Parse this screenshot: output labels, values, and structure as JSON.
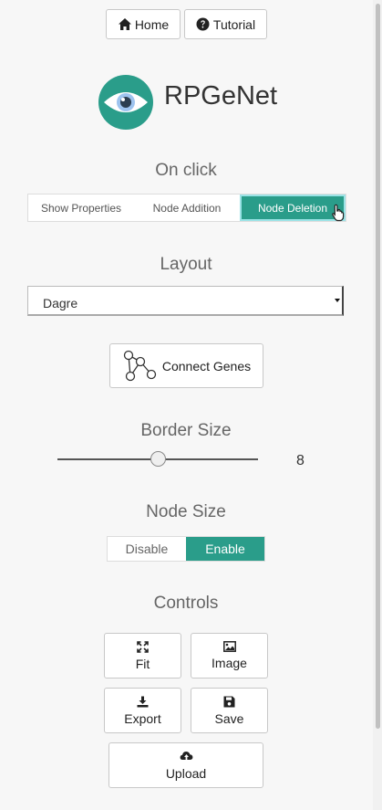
{
  "nav": {
    "home_label": "Home",
    "tutorial_label": "Tutorial"
  },
  "brand": {
    "name": "RPGeNet",
    "logo_icon": "eye-icon",
    "accent_color": "#2a9d8a"
  },
  "on_click": {
    "heading": "On click",
    "options": [
      "Show Properties",
      "Node Addition",
      "Node Deletion"
    ],
    "selected": "Node Deletion"
  },
  "layout": {
    "heading": "Layout",
    "selected": "Dagre"
  },
  "connect": {
    "label": "Connect Genes",
    "icon": "graph-nodes-icon"
  },
  "border_size": {
    "heading": "Border Size",
    "value": 8,
    "value_text": "8",
    "slider_fraction": 0.5
  },
  "node_size": {
    "heading": "Node Size",
    "options": [
      "Disable",
      "Enable"
    ],
    "selected": "Enable"
  },
  "controls": {
    "heading": "Controls",
    "buttons": [
      {
        "label": "Fit",
        "icon": "fit-icon"
      },
      {
        "label": "Image",
        "icon": "image-icon"
      },
      {
        "label": "Export",
        "icon": "download-icon"
      },
      {
        "label": "Save",
        "icon": "save-icon"
      },
      {
        "label": "Upload",
        "icon": "cloud-upload-icon"
      }
    ]
  }
}
